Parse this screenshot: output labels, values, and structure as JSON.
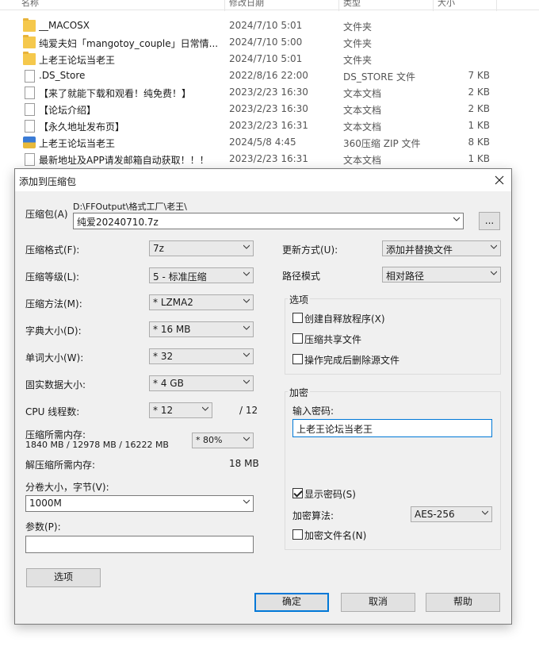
{
  "explorer": {
    "columns": {
      "name": "名称",
      "date": "修改日期",
      "type": "类型",
      "size": "大小"
    },
    "rows": [
      {
        "name": "__MACOSX",
        "date": "2024/7/10 5:01",
        "type": "文件夹",
        "size": "",
        "icon": "folder-icon"
      },
      {
        "name": "纯爱夫妇「mangotoy_couple」日常情...",
        "date": "2024/7/10 5:00",
        "type": "文件夹",
        "size": "",
        "icon": "folder-icon"
      },
      {
        "name": "上老王论坛当老王",
        "date": "2024/7/10 5:01",
        "type": "文件夹",
        "size": "",
        "icon": "folder-icon"
      },
      {
        "name": ".DS_Store",
        "date": "2022/8/16 22:00",
        "type": "DS_STORE 文件",
        "size": "7 KB",
        "icon": "file-icon"
      },
      {
        "name": "【来了就能下载和观看！纯免费！】",
        "date": "2023/2/23 16:30",
        "type": "文本文档",
        "size": "2 KB",
        "icon": "file-icon"
      },
      {
        "name": "【论坛介绍】",
        "date": "2023/2/23 16:30",
        "type": "文本文档",
        "size": "2 KB",
        "icon": "file-icon"
      },
      {
        "name": "【永久地址发布页】",
        "date": "2023/2/23 16:31",
        "type": "文本文档",
        "size": "1 KB",
        "icon": "file-icon"
      },
      {
        "name": "上老王论坛当老王",
        "date": "2024/5/8 4:45",
        "type": "360压缩 ZIP 文件",
        "size": "8 KB",
        "icon": "zip-icon"
      },
      {
        "name": "最新地址及APP请发邮箱自动获取！！！",
        "date": "2023/2/23 16:31",
        "type": "文本文档",
        "size": "1 KB",
        "icon": "file-icon"
      }
    ]
  },
  "dialog": {
    "title": "添加到压缩包",
    "archive_label": "压缩包(A)",
    "archive_path": "D:\\FFOutput\\格式工厂\\老王\\",
    "archive_name": "纯爱20240710.7z",
    "browse_label": "...",
    "format_label": "压缩格式(F):",
    "format_value": "7z",
    "level_label": "压缩等级(L):",
    "level_value": "5 - 标准压缩",
    "method_label": "压缩方法(M):",
    "method_value": "* LZMA2",
    "dict_label": "字典大小(D):",
    "dict_value": "* 16 MB",
    "word_label": "单词大小(W):",
    "word_value": "* 32",
    "solid_label": "固实数据大小:",
    "solid_value": "* 4 GB",
    "threads_label": "CPU 线程数:",
    "threads_value": "* 12",
    "threads_max": "/ 12",
    "mem_comp_label": "压缩所需内存:",
    "mem_comp_value": "1840 MB / 12978 MB / 16222 MB",
    "mem_percent": "* 80%",
    "mem_decomp_label": "解压缩所需内存:",
    "mem_decomp_value": "18 MB",
    "split_label": "分卷大小，字节(V):",
    "split_value": "1000M",
    "params_label": "参数(P):",
    "params_value": "",
    "options_button": "选项",
    "update_label": "更新方式(U):",
    "update_value": "添加并替换文件",
    "path_label": "路径模式",
    "path_value": "相对路径",
    "options_group": "选项",
    "opt_sfx": "创建自释放程序(X)",
    "opt_shared": "压缩共享文件",
    "opt_delete": "操作完成后删除源文件",
    "enc_group": "加密",
    "password_label": "输入密码:",
    "password_value": "上老王论坛当老王",
    "show_password": "显示密码(S)",
    "enc_method_label": "加密算法:",
    "enc_method_value": "AES-256",
    "enc_names": "加密文件名(N)",
    "ok": "确定",
    "cancel": "取消",
    "help": "帮助"
  }
}
